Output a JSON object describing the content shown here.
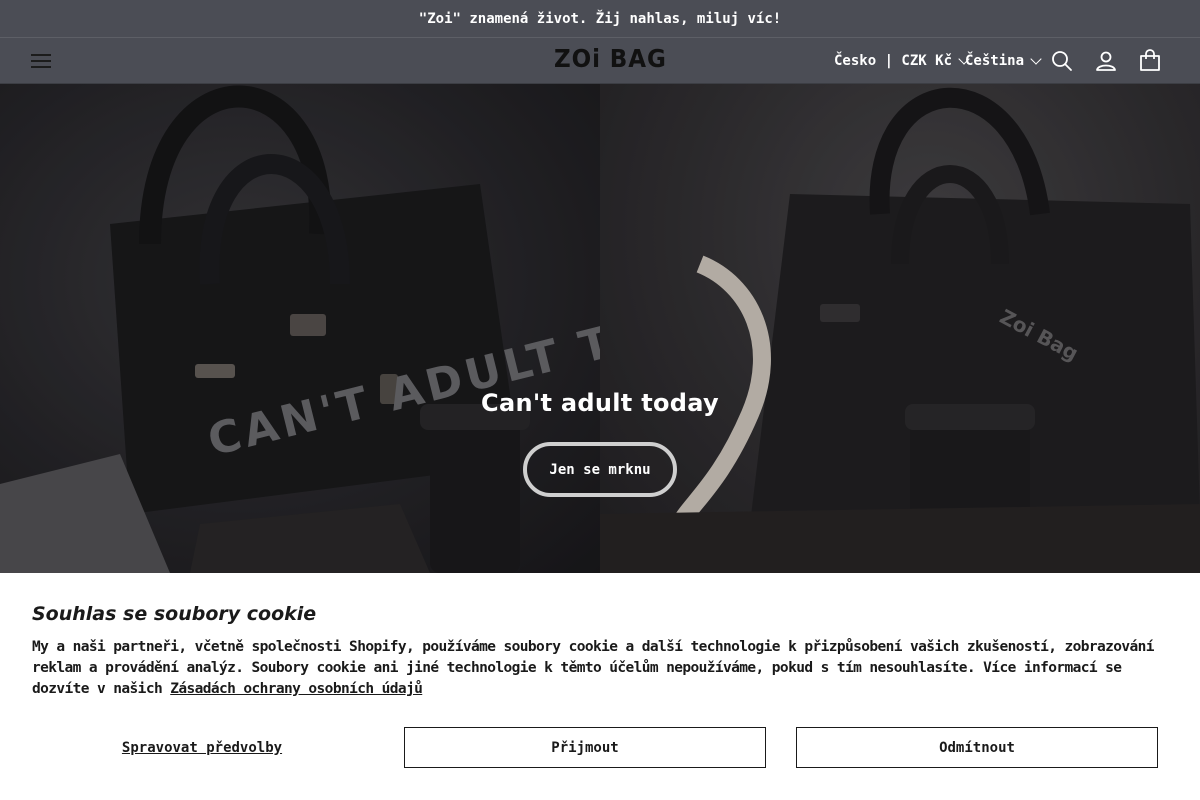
{
  "announcement": {
    "text": "\"Zoi\" znamená život. Žij nahlas, miluj víc!"
  },
  "header": {
    "logo": "ZOi BAG",
    "country_selector": "Česko | CZK Kč",
    "language_selector": "Čeština",
    "icons": [
      "menu-icon",
      "search-icon",
      "account-icon",
      "cart-icon"
    ]
  },
  "hero": {
    "heading": "Can't adult today",
    "button_label": "Jen se mrknu",
    "bag_text_left": "CAN'T ADULT TODAY",
    "bag_text_right": "Zoi Bag"
  },
  "cookie_banner": {
    "title": "Souhlas se soubory cookie",
    "body": "My a naši partneři, včetně společnosti Shopify, používáme soubory cookie a další technologie k přizpůsobení vašich zkušeností, zobrazování reklam a provádění analýz. Soubory cookie ani jiné technologie k těmto účelům nepoužíváme, pokud s tím nesouhlasíte. Více informací se dozvíte v našich ",
    "link": "Zásadách ochrany osobních údajů",
    "manage_label": "Spravovat předvolby",
    "accept_label": "Přijmout",
    "decline_label": "Odmítnout"
  },
  "colors": {
    "header_bg": "#4b4d55",
    "header_text": "#ffffff",
    "banner_bg": "#ffffff",
    "text": "#1a1a1a"
  }
}
